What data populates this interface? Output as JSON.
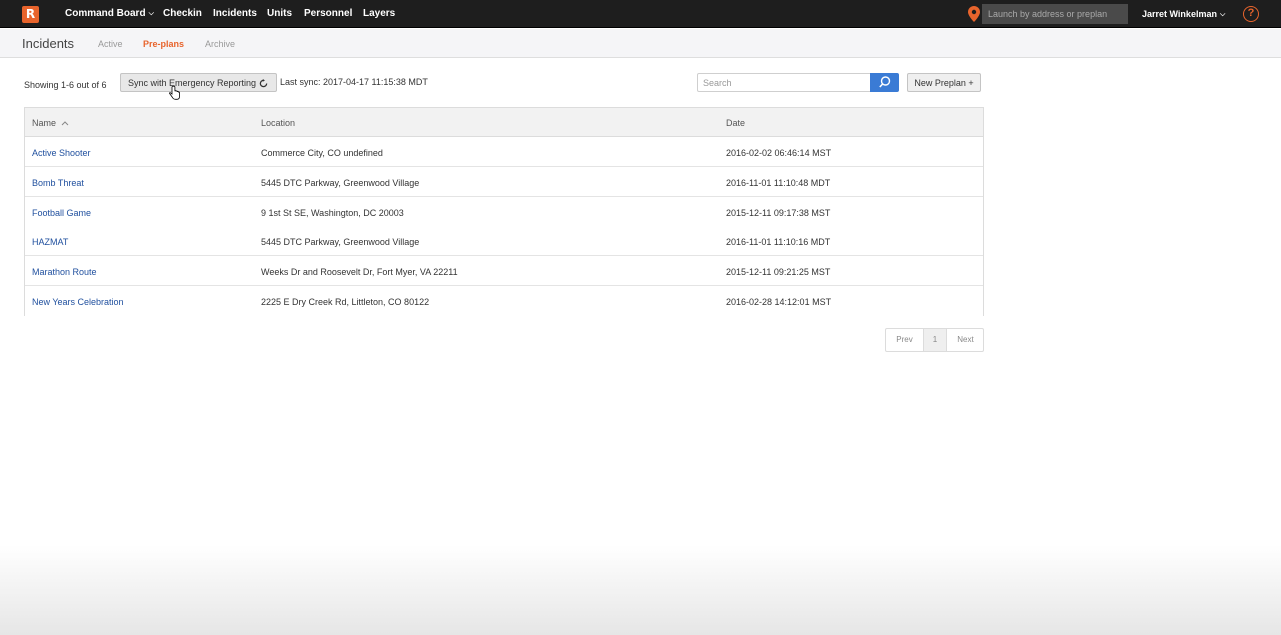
{
  "topnav": {
    "logo_letter": "R",
    "items": [
      {
        "label": "Command Board",
        "has_caret": true
      },
      {
        "label": "Checkin"
      },
      {
        "label": "Incidents"
      },
      {
        "label": "Units"
      },
      {
        "label": "Personnel"
      },
      {
        "label": "Layers"
      }
    ],
    "caret": "⌵",
    "launch_placeholder": "Launch by address or preplan",
    "user_name": "Jarret Winkelman",
    "help_glyph": "?"
  },
  "subheader": {
    "title": "Incidents",
    "tabs": [
      {
        "label": "Active",
        "active": false
      },
      {
        "label": "Pre-plans",
        "active": true
      },
      {
        "label": "Archive",
        "active": false
      }
    ]
  },
  "toolbar": {
    "showing": "Showing 1-6 out of 6",
    "sync_label": "Sync with Emergency Reporting",
    "last_sync": "Last sync: 2017-04-17 11:15:38 MDT",
    "search_placeholder": "Search",
    "new_preplan_label": "New Preplan +"
  },
  "table": {
    "headers": {
      "name": "Name",
      "name_sort": "^",
      "location": "Location",
      "date": "Date"
    },
    "rows": [
      {
        "name": "Active Shooter",
        "location": "Commerce City, CO undefined",
        "date": "2016-02-02 06:46:14 MST"
      },
      {
        "name": "Bomb Threat",
        "location": "5445 DTC Parkway, Greenwood Village",
        "date": "2016-11-01 11:10:48 MDT"
      },
      {
        "name": "Football Game",
        "location": "9 1st St SE, Washington, DC 20003",
        "date": "2015-12-11 09:17:38 MST"
      },
      {
        "name": "HAZMAT",
        "location": "5445 DTC Parkway, Greenwood Village",
        "date": "2016-11-01 11:10:16 MDT"
      },
      {
        "name": "Marathon Route",
        "location": "Weeks Dr and Roosevelt Dr, Fort Myer, VA 22211",
        "date": "2015-12-11 09:21:25 MST"
      },
      {
        "name": "New Years Celebration",
        "location": "2225 E Dry Creek Rd, Littleton, CO 80122",
        "date": "2016-02-28 14:12:01 MST"
      }
    ]
  },
  "pagination": {
    "prev": "Prev",
    "page": "1",
    "next": "Next"
  },
  "colors": {
    "accent": "#e8642c",
    "link": "#1f4f9e",
    "search_button": "#3a7bd5",
    "nav_bg": "#1e1e1e"
  },
  "icons": [
    "logo-icon",
    "chevron-down-icon",
    "location-pin-icon",
    "help-icon",
    "refresh-icon",
    "pointer-cursor-icon",
    "search-icon",
    "sort-ascending-icon"
  ]
}
